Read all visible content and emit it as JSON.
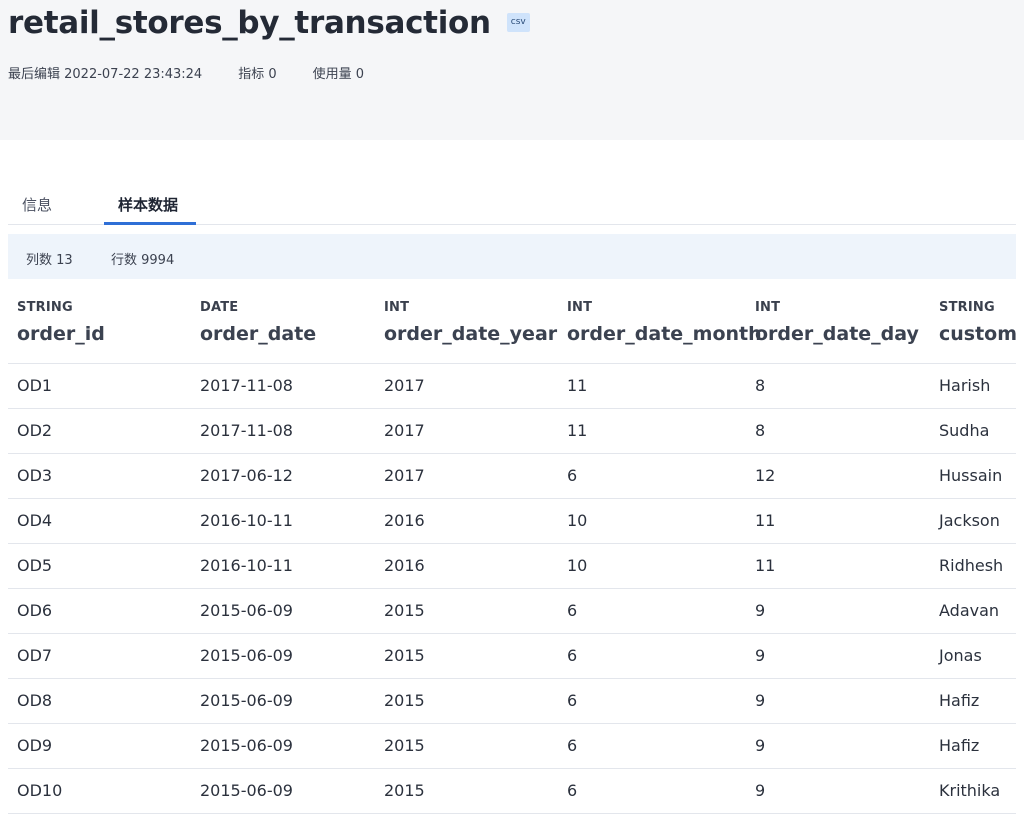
{
  "header": {
    "title": "retail_stores_by_transaction",
    "badge": "csv",
    "meta": [
      {
        "label": "最后编辑 2022-07-22 23:43:24"
      },
      {
        "label": "指标 0"
      },
      {
        "label": "使用量 0"
      }
    ]
  },
  "tabs": [
    {
      "label": "信息",
      "active": false
    },
    {
      "label": "样本数据",
      "active": true
    }
  ],
  "stats": {
    "columns": "列数 13",
    "rows": "行数 9994"
  },
  "colors": {
    "accent": "#2f6fd6",
    "stats_bg": "#eef4fb",
    "header_bg": "#f5f6f8",
    "badge_bg": "#cfe3fb"
  },
  "table": {
    "columns": [
      {
        "type": "STRING",
        "name": "order_id"
      },
      {
        "type": "DATE",
        "name": "order_date"
      },
      {
        "type": "INT",
        "name": "order_date_year"
      },
      {
        "type": "INT",
        "name": "order_date_month"
      },
      {
        "type": "INT",
        "name": "order_date_day"
      },
      {
        "type": "STRING",
        "name": "customer_name"
      }
    ],
    "rows": [
      [
        "OD1",
        "2017-11-08",
        "2017",
        "11",
        "8",
        "Harish"
      ],
      [
        "OD2",
        "2017-11-08",
        "2017",
        "11",
        "8",
        "Sudha"
      ],
      [
        "OD3",
        "2017-06-12",
        "2017",
        "6",
        "12",
        "Hussain"
      ],
      [
        "OD4",
        "2016-10-11",
        "2016",
        "10",
        "11",
        "Jackson"
      ],
      [
        "OD5",
        "2016-10-11",
        "2016",
        "10",
        "11",
        "Ridhesh"
      ],
      [
        "OD6",
        "2015-06-09",
        "2015",
        "6",
        "9",
        "Adavan"
      ],
      [
        "OD7",
        "2015-06-09",
        "2015",
        "6",
        "9",
        "Jonas"
      ],
      [
        "OD8",
        "2015-06-09",
        "2015",
        "6",
        "9",
        "Hafiz"
      ],
      [
        "OD9",
        "2015-06-09",
        "2015",
        "6",
        "9",
        "Hafiz"
      ],
      [
        "OD10",
        "2015-06-09",
        "2015",
        "6",
        "9",
        "Krithika"
      ]
    ]
  }
}
